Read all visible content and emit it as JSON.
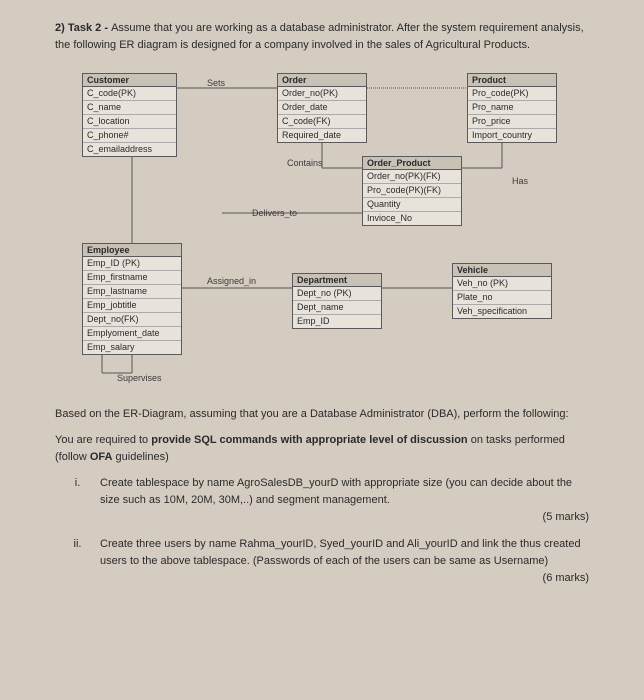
{
  "header": {
    "number": "2)",
    "title": "Task 2 - ",
    "desc": "Assume that you are working as a database administrator. After the system requirement analysis, the following ER diagram is designed for a company involved in the sales of Agricultural Products."
  },
  "entities": {
    "customer": {
      "title": "Customer",
      "attrs": [
        "C_code(PK)",
        "C_name",
        "C_location",
        "C_phone#",
        "C_emailaddress"
      ]
    },
    "order": {
      "title": "Order",
      "attrs": [
        "Order_no(PK)",
        "Order_date",
        "C_code(FK)",
        "Required_date"
      ]
    },
    "product": {
      "title": "Product",
      "attrs": [
        "Pro_code(PK)",
        "Pro_name",
        "Pro_price",
        "Import_country"
      ]
    },
    "order_product": {
      "title": "Order_Product",
      "attrs": [
        "Order_no(PK)(FK)",
        "Pro_code(PK)(FK)",
        "Quantity",
        "Invioce_No"
      ]
    },
    "employee": {
      "title": "Employee",
      "attrs": [
        "Emp_ID (PK)",
        "Emp_firstname",
        "Emp_lastname",
        "Emp_jobtitle",
        "Dept_no(FK)",
        "Emplyoment_date",
        "Emp_salary"
      ]
    },
    "department": {
      "title": "Department",
      "attrs": [
        "Dept_no (PK)",
        "Dept_name",
        "Emp_ID"
      ]
    },
    "vehicle": {
      "title": "Vehicle",
      "attrs": [
        "Veh_no (PK)",
        "Plate_no",
        "Veh_specification"
      ]
    }
  },
  "relations": {
    "sets": "Sets",
    "contains": "Contains",
    "delivers_to": "Delivers_to",
    "has": "Has",
    "assigned_in": "Assigned_in",
    "supervises": "Supervises"
  },
  "body": {
    "p1": "Based on the ER-Diagram, assuming that you are a Database Administrator (DBA), perform the following:",
    "p2a": "You are required to ",
    "p2b": "provide SQL commands with appropriate level of discussion",
    "p2c": " on tasks performed (follow ",
    "p2d": "OFA",
    "p2e": " guidelines)"
  },
  "tasks": {
    "i": {
      "num": "i.",
      "text": "Create tablespace by name AgroSalesDB_yourD with appropriate size (you can decide about the size such as 10M, 20M, 30M,..) and segment management.",
      "marks": "(5 marks)"
    },
    "ii": {
      "num": "ii.",
      "text": "Create three users by name Rahma_yourID, Syed_yourID and Ali_yourID and link the thus created users to the above tablespace. (Passwords of each of the users can be same as Username)",
      "marks": "(6 marks)"
    }
  }
}
